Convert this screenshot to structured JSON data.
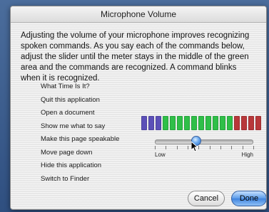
{
  "window": {
    "title": "Microphone Volume"
  },
  "intro": "Adjusting the volume of your microphone improves recognizing spoken commands. As you say each of the commands below, adjust the slider until the meter stays in the middle of the green area and the commands are recognized. A command blinks when it is recognized.",
  "commands": [
    "What Time Is It?",
    "Quit this application",
    "Open a document",
    "Show me what to say",
    "Make this page speakable",
    "Move page down",
    "Hide this application",
    "Switch to Finder"
  ],
  "meter": {
    "segments": [
      "blue",
      "blue",
      "blue",
      "green",
      "green",
      "green",
      "green",
      "green",
      "green",
      "green",
      "green",
      "green",
      "green",
      "red",
      "red",
      "red",
      "red"
    ],
    "colors": {
      "blue": "#5b4fb8",
      "green": "#2fbf48",
      "red": "#b8383a"
    }
  },
  "slider": {
    "low_label": "Low",
    "high_label": "High",
    "value": 0.41,
    "tick_count": 10
  },
  "buttons": {
    "cancel": "Cancel",
    "done": "Done"
  }
}
